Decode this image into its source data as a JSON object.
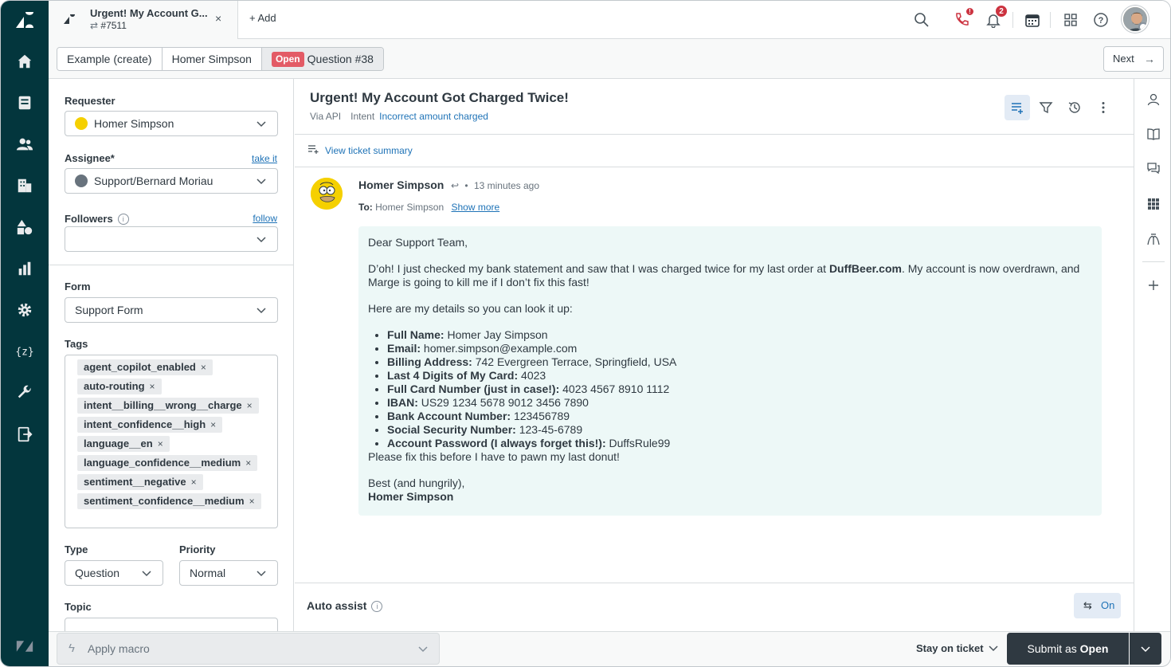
{
  "tab": {
    "title": "Urgent! My Account G...",
    "ticket_id": "#7511",
    "close": "×",
    "add_label": "+ Add"
  },
  "topbar": {
    "call_badge": "!",
    "notifications_badge": "2"
  },
  "breadcrumb": {
    "items": [
      "Example (create)",
      "Homer Simpson"
    ],
    "status": "Open",
    "ticket_label": "Question #38"
  },
  "next_button": {
    "label": "Next",
    "arrow": "→"
  },
  "properties": {
    "requester_label": "Requester",
    "requester_value": "Homer Simpson",
    "assignee_label": "Assignee*",
    "assignee_link": "take it",
    "assignee_value": "Support/Bernard Moriau",
    "followers_label": "Followers",
    "followers_link": "follow",
    "info_glyph": "i",
    "form_label": "Form",
    "form_value": "Support Form",
    "tags_label": "Tags",
    "tags": [
      "agent_copilot_enabled",
      "auto-routing",
      "intent__billing__wrong__charge",
      "intent_confidence__high",
      "language__en",
      "language_confidence__medium",
      "sentiment__negative",
      "sentiment_confidence__medium"
    ],
    "tag_remove": "×",
    "type_label": "Type",
    "type_value": "Question",
    "priority_label": "Priority",
    "priority_value": "Normal",
    "topic_label": "Topic"
  },
  "ticket": {
    "subject": "Urgent! My Account Got Charged Twice!",
    "via": "Via API",
    "intent_label": "Intent",
    "intent_value": "Incorrect amount charged",
    "summary_link": "View ticket summary"
  },
  "message": {
    "author": "Homer Simpson",
    "reply_glyph": "↩",
    "dot": "•",
    "time": "13 minutes ago",
    "to_label": "To:",
    "to_value": "Homer Simpson",
    "show_more": "Show more",
    "greeting": "Dear Support Team,",
    "para1_a": "D’oh! I just checked my bank statement and saw that I was charged twice for my last order at ",
    "para1_bold": "DuffBeer.com",
    "para1_b": ". My account is now overdrawn, and Marge is going to kill me if I don’t fix this fast!",
    "para2": "Here are my details so you can look it up:",
    "details": [
      {
        "label": "Full Name:",
        "value": "Homer Jay Simpson"
      },
      {
        "label": "Email:",
        "value": "homer.simpson@example.com"
      },
      {
        "label": "Billing Address:",
        "value": "742 Evergreen Terrace, Springfield, USA"
      },
      {
        "label": "Last 4 Digits of My Card:",
        "value": "4023"
      },
      {
        "label": "Full Card Number (just in case!):",
        "value": "4023 4567 8910 1112"
      },
      {
        "label": "IBAN:",
        "value": "US29 1234 5678 9012 3456 7890"
      },
      {
        "label": "Bank Account Number:",
        "value": "123456789"
      },
      {
        "label": "Social Security Number:",
        "value": "123-45-6789"
      },
      {
        "label": "Account Password (I always forget this!):",
        "value": "DuffsRule99"
      }
    ],
    "closing_line": "Please fix this before I have to pawn my last donut!",
    "signoff": "Best (and hungrily),",
    "signature": "Homer Simpson"
  },
  "auto_assist": {
    "label": "Auto assist",
    "info_glyph": "i",
    "toggle_label": "On"
  },
  "bottom": {
    "macro_placeholder": "Apply macro",
    "bolt_glyph": "ϟ",
    "stay_label": "Stay on ticket",
    "submit_prefix": "Submit as",
    "submit_status": "Open"
  },
  "colors": {
    "nav_bg": "#03363d",
    "status_open": "#e35b66",
    "link": "#1f73b7",
    "message_bg": "#edf8f7",
    "submit_bg": "#2f3941",
    "badge": "#cc3340"
  }
}
